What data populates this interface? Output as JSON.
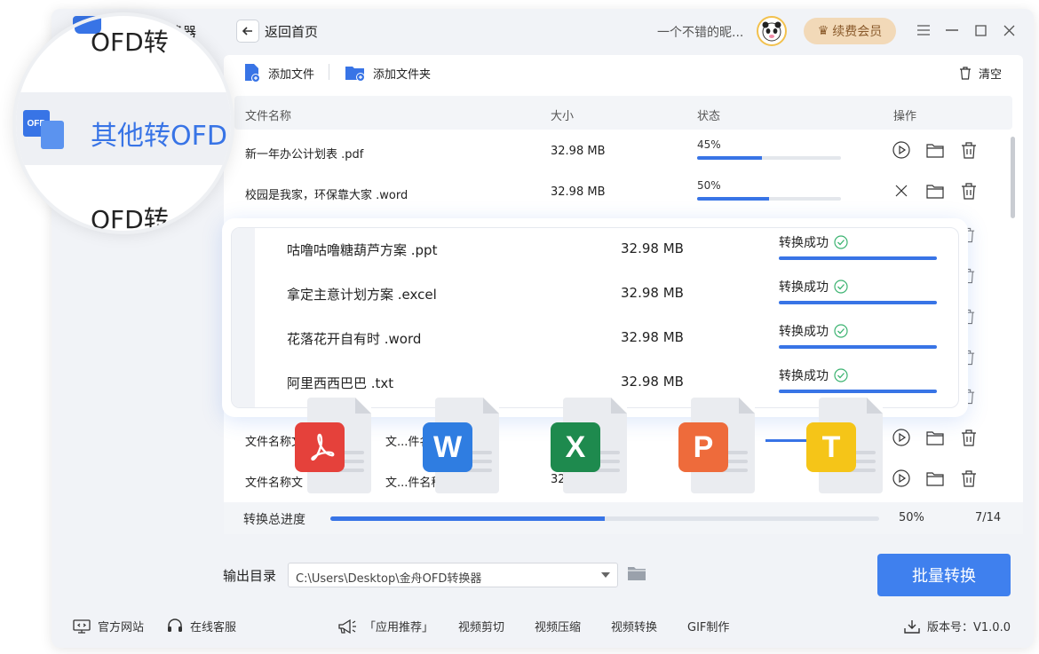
{
  "sidebar": {
    "title_partial": "转换器",
    "magnified": {
      "item1": "OFD转",
      "item2": "其他转OFD",
      "item3": "OFD转"
    }
  },
  "header": {
    "back_label": "返回首页",
    "username": "一个不错的昵...",
    "vip_label": "续费会员"
  },
  "toolbar": {
    "add_file": "添加文件",
    "add_folder": "添加文件夹",
    "clear": "清空"
  },
  "table": {
    "headers": {
      "name": "文件名称",
      "size": "大小",
      "status": "状态",
      "ops": "操作"
    },
    "rows": [
      {
        "name": "新一年办公计划表 .pdf",
        "size": "32.98 MB",
        "percent_label": "45%",
        "progress": 0.45
      },
      {
        "name": "校园是我家，环保靠大家 .word",
        "size": "32.98 MB",
        "percent_label": "50%",
        "progress": 0.5
      },
      {
        "name": "文件名称文...件名",
        "name_b": "文件名称文",
        "size": "32"
      },
      {
        "name": "文件名称文...件名",
        "name_b": "文件名称文",
        "size": "32"
      }
    ],
    "partial_rows": [
      {
        "name_a": "文件名称文",
        "name_b": "文...件名",
        "size": ""
      },
      {
        "name_a": "文件名称文",
        "name_b": "文...件名称",
        "size": "32"
      }
    ]
  },
  "popup": {
    "rows": [
      {
        "name": "咕噜咕噜糖葫芦方案 .ppt",
        "size": "32.98 MB",
        "status": "转换成功"
      },
      {
        "name": "拿定主意计划方案 .excel",
        "size": "32.98 MB",
        "status": "转换成功"
      },
      {
        "name": "花落花开自有时 .word",
        "size": "32.98 MB",
        "status": "转换成功"
      },
      {
        "name": "阿里西西巴巴 .txt",
        "size": "32.98 MB",
        "status": "转换成功"
      }
    ]
  },
  "file_icons": [
    {
      "letter": "",
      "type": "pdf",
      "color": "#e5413b"
    },
    {
      "letter": "W",
      "type": "word",
      "color": "#2f7de1"
    },
    {
      "letter": "X",
      "type": "excel",
      "color": "#1e8a4e"
    },
    {
      "letter": "P",
      "type": "ppt",
      "color": "#ee6b3b"
    },
    {
      "letter": "T",
      "type": "txt",
      "color": "#f5c518"
    }
  ],
  "total": {
    "label": "转换总进度",
    "percent_label": "50%",
    "progress": 0.5,
    "count": "7/14"
  },
  "output": {
    "label": "输出目录",
    "path": "C:\\Users\\Desktop\\金舟OFD转换器"
  },
  "batch_button": "批量转换",
  "footer": {
    "website": "官方网站",
    "support": "在线客服",
    "recommend": "「应用推荐」",
    "links": [
      "视频剪切",
      "视频压缩",
      "视频转换",
      "GIF制作"
    ],
    "version": "版本号：V1.0.0"
  },
  "colors": {
    "accent": "#3874e6",
    "vip_bg": "#f2d9b8",
    "vip_text": "#8a5a2b",
    "success": "#3cb371"
  }
}
